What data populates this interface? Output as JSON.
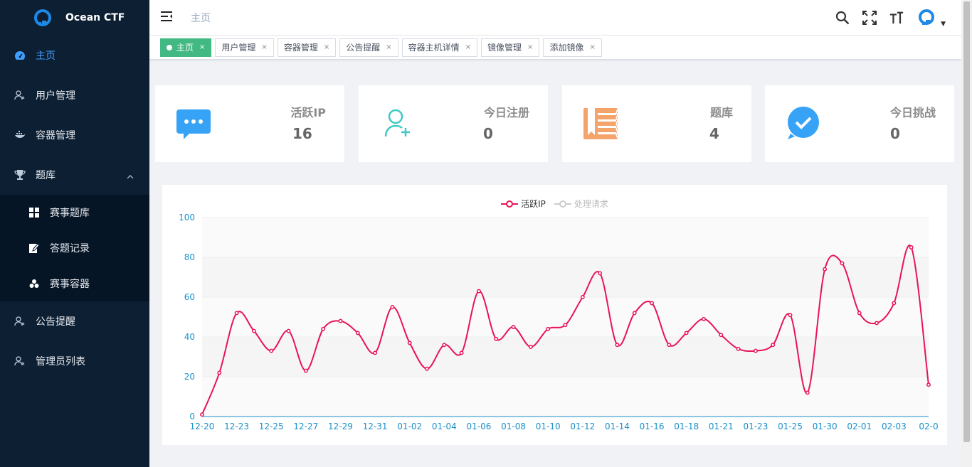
{
  "brand": {
    "title": "Ocean CTF"
  },
  "sidebar": {
    "items": [
      {
        "label": "主页",
        "icon": "dashboard-icon"
      },
      {
        "label": "用户管理",
        "icon": "user-icon"
      },
      {
        "label": "容器管理",
        "icon": "docker-icon"
      },
      {
        "label": "题库",
        "icon": "trophy-icon"
      },
      {
        "label": "公告提醒",
        "icon": "user-icon"
      },
      {
        "label": "管理员列表",
        "icon": "user-icon"
      }
    ],
    "submenu": [
      {
        "label": "赛事题库",
        "icon": "grid-icon"
      },
      {
        "label": "答题记录",
        "icon": "edit-icon"
      },
      {
        "label": "赛事容器",
        "icon": "cluster-icon"
      }
    ]
  },
  "header": {
    "breadcrumb": "主页"
  },
  "tags": [
    {
      "label": "主页",
      "active": true
    },
    {
      "label": "用户管理"
    },
    {
      "label": "容器管理"
    },
    {
      "label": "公告提醒"
    },
    {
      "label": "容器主机详情"
    },
    {
      "label": "镜像管理"
    },
    {
      "label": "添加镜像"
    }
  ],
  "tag_close": "×",
  "cards": [
    {
      "label": "活跃IP",
      "value": "16",
      "icon": "message-icon",
      "color": "#36a3f7"
    },
    {
      "label": "今日注册",
      "value": "0",
      "icon": "add-user-icon",
      "color": "#40c9c6"
    },
    {
      "label": "题库",
      "value": "4",
      "icon": "book-icon",
      "color": "#f4a36b"
    },
    {
      "label": "今日挑战",
      "value": "0",
      "icon": "check-icon",
      "color": "#36a3f7"
    }
  ],
  "colors": {
    "sidebar_bg": "#0d1f33",
    "accent": "#409eff",
    "tag_active": "#42b983",
    "series_active": "#e81456",
    "series_inactive": "#cccccc",
    "axis": "#1890c8"
  },
  "chart_data": {
    "type": "line",
    "legend": [
      {
        "name": "活跃IP",
        "color": "#e81456",
        "active": true
      },
      {
        "name": "处理请求",
        "color": "#cccccc",
        "active": false
      }
    ],
    "x_tick_labels": [
      "12-20",
      "12-23",
      "12-25",
      "12-27",
      "12-29",
      "12-31",
      "01-02",
      "01-04",
      "01-06",
      "01-08",
      "01-10",
      "01-12",
      "01-14",
      "01-16",
      "01-18",
      "01-21",
      "01-23",
      "01-25",
      "01-30",
      "02-01",
      "02-03",
      "02-0"
    ],
    "y_ticks": [
      0,
      20,
      40,
      60,
      80,
      100
    ],
    "ylim": [
      0,
      100
    ],
    "series": [
      {
        "name": "活跃IP",
        "values": [
          1,
          22,
          52,
          43,
          33,
          43,
          23,
          44,
          48,
          42,
          32,
          55,
          37,
          24,
          36,
          32,
          63,
          39,
          45,
          35,
          44,
          46,
          60,
          72,
          36,
          52,
          57,
          36,
          42,
          49,
          41,
          34,
          33,
          36,
          51,
          12,
          74,
          77,
          52,
          47,
          57,
          85,
          16
        ]
      }
    ]
  }
}
